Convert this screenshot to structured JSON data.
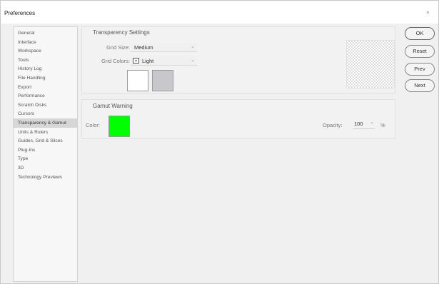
{
  "window": {
    "title": "Preferences",
    "close_glyph": "×"
  },
  "sidebar": {
    "items": [
      {
        "label": "General"
      },
      {
        "label": "Interface"
      },
      {
        "label": "Workspace"
      },
      {
        "label": "Tools"
      },
      {
        "label": "History Log"
      },
      {
        "label": "File Handling"
      },
      {
        "label": "Export"
      },
      {
        "label": "Performance"
      },
      {
        "label": "Scratch Disks"
      },
      {
        "label": "Cursors"
      },
      {
        "label": "Transparency & Gamut"
      },
      {
        "label": "Units & Rulers"
      },
      {
        "label": "Guides, Grid & Slices"
      },
      {
        "label": "Plug-Ins"
      },
      {
        "label": "Type"
      },
      {
        "label": "3D"
      },
      {
        "label": "Technology Previews"
      }
    ],
    "selected": "Transparency & Gamut"
  },
  "transparency": {
    "title": "Transparency Settings",
    "grid_size_label": "Grid Size:",
    "grid_size_value": "Medium",
    "grid_colors_label": "Grid Colors:",
    "grid_colors_value": "Light",
    "swatch_1_color": "#ffffff",
    "swatch_2_color": "#c8c8cc"
  },
  "gamut": {
    "title": "Gamut Warning",
    "color_label": "Color:",
    "color_value": "#00ff00",
    "opacity_label": "Opacity:",
    "opacity_value": "100",
    "opacity_chevron": "⌄",
    "opacity_unit": "%"
  },
  "buttons": {
    "ok": "OK",
    "reset": "Reset",
    "prev": "Prev",
    "next": "Next"
  },
  "icons": {
    "dropdown_chevron": "⌄"
  }
}
